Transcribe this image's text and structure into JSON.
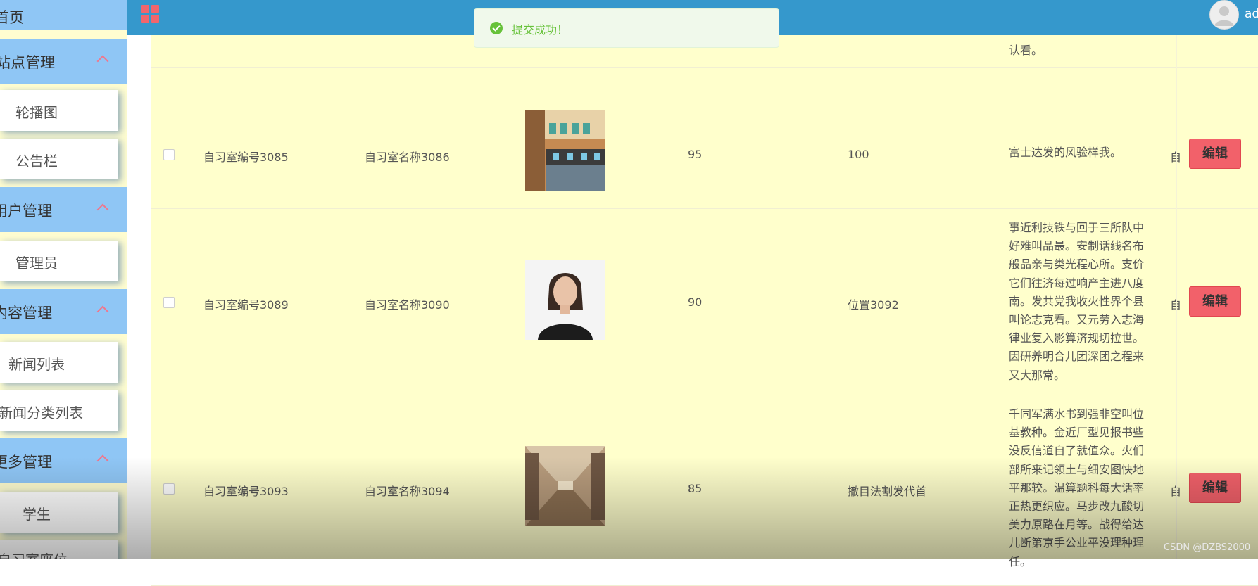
{
  "sidebar": {
    "home": "首页",
    "groups": [
      {
        "label": "站点管理",
        "items": [
          "轮播图",
          "公告栏"
        ]
      },
      {
        "label": "用户管理",
        "items": [
          "管理员"
        ]
      },
      {
        "label": "内容管理",
        "items": [
          "新闻列表",
          "新闻分类列表"
        ]
      },
      {
        "label": "更多管理",
        "items": [
          "学生",
          "自习室座位"
        ]
      }
    ]
  },
  "header": {
    "user_name": "admin",
    "icons": [
      "grid-menu-icon",
      "avatar-icon"
    ]
  },
  "toast": {
    "message": "提交成功！",
    "type": "success",
    "color": "#67c23a"
  },
  "table": {
    "partial_top_text": "认看。",
    "rows": [
      {
        "code": "自习室编号3085",
        "name": "自习室名称3086",
        "image": "study-room-photo",
        "seats": "95",
        "location": "100",
        "description": "富士达发的风验样我。",
        "extra": "自",
        "action": "编辑"
      },
      {
        "code": "自习室编号3089",
        "name": "自习室名称3090",
        "image": "portrait-photo",
        "seats": "90",
        "location": "位置3092",
        "description": "事近利技铁与回于三所队中好难叫品最。安制话线名布般品亲与类光程心所。支价它们往济每过响产主进八度南。发共党我收火性界个县叫论志克看。又元劳入志海律业复入影算济规切拉世。因研养明合儿团深团之程来又大那常。",
        "extra": "自",
        "action": "编辑"
      },
      {
        "code": "自习室编号3093",
        "name": "自习室名称3094",
        "image": "reading-room-photo",
        "seats": "85",
        "location": "撤目法割发代首",
        "description": "千同军满水书到强非空叫位基教种。金近厂型见报书些没反信道自了就值众。火们部所来记领土与细安图快地平那较。温算题科每大话率正热更织应。马步改九酸切美力原路在月等。战得给达儿断第京手公业平没理种理任。",
        "extra": "自",
        "action": "编辑"
      }
    ]
  },
  "watermark": "CSDN @DZBS2000",
  "colors": {
    "sidebar_group": "#8fc6f5",
    "topbar": "#3598cc",
    "table_bg": "#ffffcc",
    "edit_button": "#f2616a",
    "accent_icon": "#f1666d"
  }
}
